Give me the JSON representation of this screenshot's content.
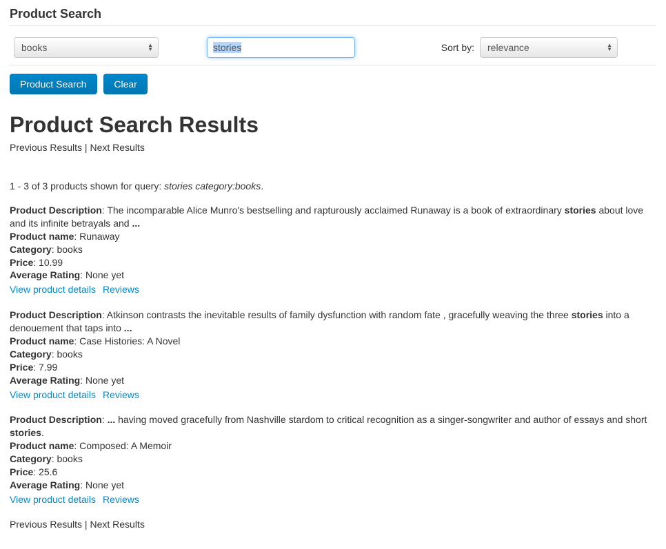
{
  "header": {
    "title": "Product Search"
  },
  "search": {
    "category_value": "books",
    "query_value": "stories",
    "sort_label": "Sort by:",
    "sort_value": "relevance"
  },
  "buttons": {
    "search": "Product Search",
    "clear": "Clear"
  },
  "results": {
    "title": "Product Search Results",
    "pager_prev": "Previous Results",
    "pager_sep": " | ",
    "pager_next": "Next Results",
    "summary_prefix": "1 - 3 of 3 products shown for query: ",
    "summary_query": "stories category:books",
    "summary_suffix": "."
  },
  "labels": {
    "desc": "Product Description",
    "name": "Product name",
    "category": "Category",
    "price": "Price",
    "rating": "Average Rating",
    "view": "View product details",
    "reviews": "Reviews"
  },
  "products": [
    {
      "desc_pre": "The incomparable Alice Munro's bestselling and rapturously acclaimed Runaway is a book of extraordinary ",
      "desc_hl": "stories",
      "desc_post": " about love and its infinite betrayals and ",
      "desc_ellipsis": "...",
      "name": "Runaway",
      "category": "books",
      "price": "10.99",
      "rating": "None yet"
    },
    {
      "desc_pre": "Atkinson contrasts the inevitable results of family dysfunction with random fate , gracefully weaving the three ",
      "desc_hl": "stories",
      "desc_post": " into a denouement that taps into ",
      "desc_ellipsis": "...",
      "name": "Case Histories: A Novel",
      "category": "books",
      "price": "7.99",
      "rating": "None yet"
    },
    {
      "desc_lead_ellipsis": "...",
      "desc_pre": " having moved gracefully from Nashville stardom to critical recognition as a singer-songwriter and author of essays and short ",
      "desc_hl": "stories",
      "desc_post": ".",
      "desc_ellipsis": "",
      "name": "Composed: A Memoir",
      "category": "books",
      "price": "25.6",
      "rating": "None yet"
    }
  ]
}
